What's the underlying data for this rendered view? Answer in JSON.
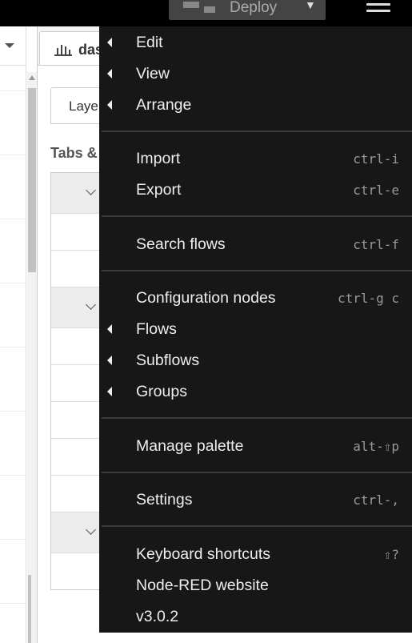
{
  "header": {
    "deploy_label": "Deploy"
  },
  "sidebar": {
    "tab_label": "das",
    "layout_tab_label": "Laye",
    "section_title": "Tabs &"
  },
  "menu": {
    "items": [
      {
        "label": "Edit",
        "shortcut": ""
      },
      {
        "label": "View",
        "shortcut": ""
      },
      {
        "label": "Arrange",
        "shortcut": ""
      },
      {
        "label": "Import",
        "shortcut": "ctrl-i"
      },
      {
        "label": "Export",
        "shortcut": "ctrl-e"
      },
      {
        "label": "Search flows",
        "shortcut": "ctrl-f"
      },
      {
        "label": "Configuration nodes",
        "shortcut": "ctrl-g c"
      },
      {
        "label": "Flows",
        "shortcut": ""
      },
      {
        "label": "Subflows",
        "shortcut": ""
      },
      {
        "label": "Groups",
        "shortcut": ""
      },
      {
        "label": "Manage palette",
        "shortcut": "alt-⇧p"
      },
      {
        "label": "Settings",
        "shortcut": "ctrl-,"
      },
      {
        "label": "Keyboard shortcuts",
        "shortcut": "⇧?"
      },
      {
        "label": "Node-RED website",
        "shortcut": ""
      },
      {
        "label": "v3.0.2",
        "shortcut": ""
      }
    ]
  },
  "colors": {
    "menu_background": "#171717",
    "menu_text": "#eeeeee",
    "header_background": "#000000"
  }
}
